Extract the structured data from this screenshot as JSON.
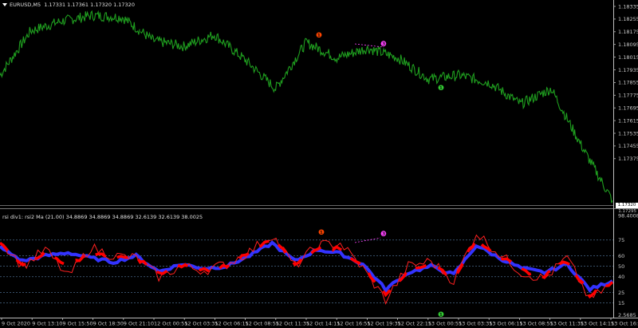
{
  "main_header": {
    "arrow_icon": "triangle-down-icon",
    "symbol": "EURUSD,M5",
    "ohlc": "1.17331 1.17361 1.17320 1.17320"
  },
  "main_axis": [
    "1.18335",
    "1.18255",
    "1.18175",
    "1.18095",
    "1.18015",
    "1.17935",
    "1.17855",
    "1.17775",
    "1.17695",
    "1.17615",
    "1.17535",
    "1.17455",
    "1.17375"
  ],
  "current_price": "1.17320",
  "current_price_lower": "1.17295",
  "signal_markers": [
    {
      "glyph": "❶",
      "color": "#ff4500"
    },
    {
      "glyph": "❸",
      "color": "#ff44ff"
    },
    {
      "glyph": "❶",
      "color": "#33cc33"
    }
  ],
  "rsi_header": "rsi div1: rsi2 Ma (21.00) 34.8869 34.8869 34.8869 32.6139 32.6139 38.0025",
  "rsi_axis": {
    "top": "98.4008",
    "levels": [
      "75",
      "60",
      "50",
      "40",
      "25",
      "15"
    ],
    "bottom": "2.5685"
  },
  "time_labels": [
    "9 Oct 2020",
    "9 Oct 13:10",
    "9 Oct 15:50",
    "9 Oct 18:30",
    "9 Oct 21:10",
    "12 Oct 00:55",
    "12 Oct 03:35",
    "12 Oct 06:15",
    "12 Oct 08:55",
    "12 Oct 11:35",
    "12 Oct 14:15",
    "12 Oct 16:55",
    "12 Oct 19:35",
    "12 Oct 22:15",
    "13 Oct 00:55",
    "13 Oct 03:35",
    "13 Oct 06:15",
    "13 Oct 08:55",
    "13 Oct 11:35",
    "13 Oct 14:15",
    "13 Oct 16:55"
  ],
  "chart_data": [
    {
      "type": "line",
      "title": "EURUSD,M5",
      "series": [
        {
          "name": "EURUSD,M5",
          "color": "#1f9e1f",
          "x": [
            "9 Oct 2020",
            "9 Oct 13:10",
            "9 Oct 15:50",
            "9 Oct 18:30",
            "9 Oct 21:10",
            "12 Oct 00:55",
            "12 Oct 03:35",
            "12 Oct 06:15",
            "12 Oct 08:55",
            "12 Oct 11:35",
            "12 Oct 14:15",
            "12 Oct 16:55",
            "12 Oct 19:35",
            "12 Oct 22:15",
            "13 Oct 00:55",
            "13 Oct 03:35",
            "13 Oct 06:15",
            "13 Oct 08:55",
            "13 Oct 11:35",
            "13 Oct 14:15",
            "13 Oct 16:55"
          ],
          "values": [
            1.1797,
            1.182,
            1.1825,
            1.1828,
            1.1827,
            1.1815,
            1.1812,
            1.1818,
            1.1805,
            1.179,
            1.1814,
            1.1806,
            1.1811,
            1.1806,
            1.1795,
            1.1797,
            1.1793,
            1.1782,
            1.179,
            1.176,
            1.1732
          ]
        }
      ],
      "ylim": [
        1.1728,
        1.1836
      ],
      "grid": false
    },
    {
      "type": "line",
      "title": "rsi div1: rsi2 Ma (21.00)",
      "series": [
        {
          "name": "rsi2 Ma",
          "color": "#3333ff",
          "values": [
            68,
            55,
            60,
            63,
            58,
            54,
            60,
            45,
            52,
            48,
            50,
            60,
            72,
            55,
            66,
            62,
            52,
            28,
            44,
            50,
            42,
            70,
            58,
            48,
            44,
            52,
            28,
            36
          ]
        },
        {
          "name": "rsi2",
          "color": "#ff2020",
          "values": [
            75,
            50,
            66,
            40,
            68,
            60,
            58,
            40,
            50,
            46,
            52,
            64,
            80,
            50,
            70,
            72,
            48,
            18,
            50,
            55,
            36,
            82,
            62,
            44,
            38,
            58,
            18,
            34
          ]
        }
      ],
      "levels": [
        75,
        60,
        50,
        40,
        25,
        15
      ],
      "ylim": [
        2.5685,
        98.4008
      ]
    }
  ]
}
